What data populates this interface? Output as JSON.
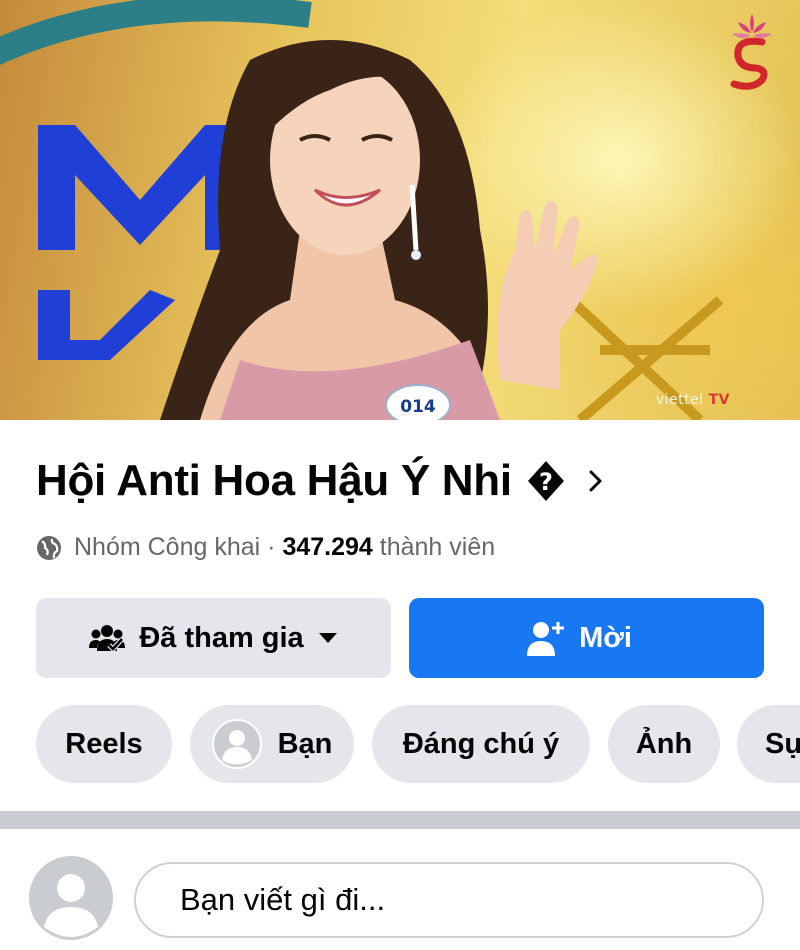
{
  "cover": {
    "photo_credit_prefix": "viettel",
    "photo_credit_suffix": "TV",
    "contestant_number": "014",
    "brand_logo": "flower-s-logo"
  },
  "group": {
    "title": "Hội Anti Hoa Hậu Ý Nhi",
    "title_glyph": "?",
    "privacy_label": "Nhóm Công khai",
    "separator": " · ",
    "member_count": "347.294",
    "member_suffix": " thành viên"
  },
  "actions": {
    "joined_label": "Đã tham gia",
    "invite_label": "Mời"
  },
  "tabs": [
    {
      "label": "Reels"
    },
    {
      "label": "Bạn"
    },
    {
      "label": "Đáng chú ý"
    },
    {
      "label": "Ảnh"
    },
    {
      "label": "Sự kiện"
    }
  ],
  "composer": {
    "placeholder": "Bạn viết gì đi..."
  },
  "colors": {
    "primary": "#1877f2",
    "secondary_button": "#e4e6eb",
    "meta_text": "#65676b",
    "divider": "#c9ccd1"
  },
  "icons": [
    "globe-icon",
    "group-joined-icon",
    "caret-down-icon",
    "add-person-icon",
    "chevron-right-icon",
    "default-avatar-icon"
  ]
}
